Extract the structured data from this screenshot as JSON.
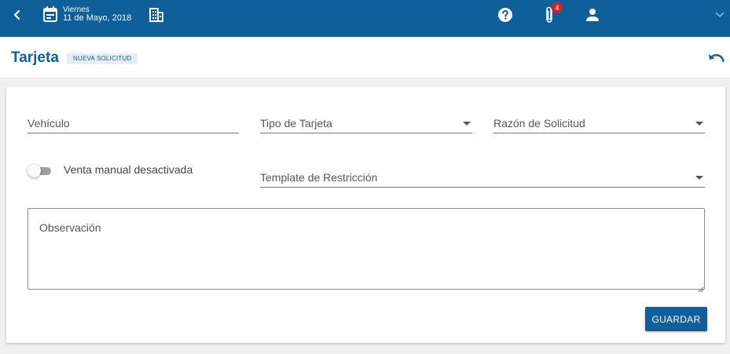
{
  "header": {
    "date_day": "Viernes",
    "date_full": "11 de Mayo, 2018",
    "attachments_count": "4",
    "icons": [
      "back-arrow-icon",
      "calendar-icon",
      "building-icon",
      "help-icon",
      "paperclip-icon",
      "person-icon",
      "chevron-down-icon"
    ]
  },
  "page": {
    "title": "Tarjeta",
    "badge": "NUEVA SOLICITUD"
  },
  "form": {
    "vehiculo_label": "Vehículo",
    "tipo_tarjeta_label": "Tipo de Tarjeta",
    "razon_solicitud_label": "Razón de Solicitud",
    "venta_manual_label": "Venta manual desactivada",
    "venta_manual_on": false,
    "template_restriccion_label": "Template de Restricción",
    "observacion_placeholder": "Observación",
    "save_label": "GUARDAR"
  },
  "colors": {
    "primary": "#0f5f9a",
    "badge_red": "#c62828",
    "background": "#f0f0f0"
  }
}
